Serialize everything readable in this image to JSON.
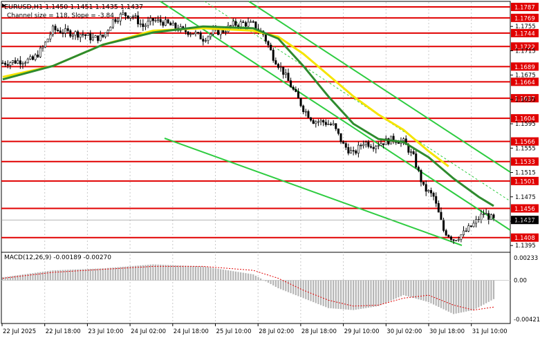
{
  "header": {
    "symbol_line": "EURUSD,H1  1.1450 1.1451 1.1435 1.1437",
    "channel_line": "Channel size = 118, Slope = -3.84"
  },
  "macd": {
    "label": "MACD(12,26,9) -0.00189 -0.00270",
    "scale_ticks": [
      "0.00233",
      "0.00",
      "-0.00421"
    ]
  },
  "price_scale": {
    "ticks": [
      "1.1755",
      "1.1715",
      "1.1675",
      "1.1635",
      "1.1595",
      "1.1555",
      "1.1515",
      "1.1475",
      "1.1435",
      "1.1395"
    ]
  },
  "levels": [
    {
      "label": "1.1787",
      "value": 1.1787
    },
    {
      "label": "1.1769",
      "value": 1.1769
    },
    {
      "label": "1.1744",
      "value": 1.1744
    },
    {
      "label": "1.1722",
      "value": 1.1722
    },
    {
      "label": "1.1689",
      "value": 1.1689
    },
    {
      "label": "1.1664",
      "value": 1.1664
    },
    {
      "label": "1.1637",
      "value": 1.1637
    },
    {
      "label": "1.1604",
      "value": 1.1604
    },
    {
      "label": "1.1566",
      "value": 1.1566
    },
    {
      "label": "1.1533",
      "value": 1.1533
    },
    {
      "label": "1.1501",
      "value": 1.1501
    },
    {
      "label": "1.1456",
      "value": 1.1456
    },
    {
      "label": "1.1408",
      "value": 1.1408
    }
  ],
  "current_price": {
    "label": "1.1437",
    "value": 1.1437
  },
  "time_axis": {
    "labels": [
      "22 Jul 2025",
      "22 Jul 18:00",
      "23 Jul 10:00",
      "24 Jul 02:00",
      "24 Jul 18:00",
      "25 Jul 10:00",
      "28 Jul 02:00",
      "28 Jul 18:00",
      "29 Jul 10:00",
      "30 Jul 02:00",
      "30 Jul 18:00",
      "31 Jul 10:00"
    ]
  },
  "chart_data": {
    "type": "candlestick",
    "symbol": "EURUSD",
    "timeframe": "H1",
    "ylim": [
      1.1385,
      1.1795
    ],
    "close_path": [
      [
        0,
        1.1695
      ],
      [
        6,
        1.1698
      ],
      [
        12,
        1.17
      ],
      [
        16,
        1.172
      ],
      [
        20,
        1.175
      ],
      [
        26,
        1.1745
      ],
      [
        32,
        1.1742
      ],
      [
        36,
        1.1735
      ],
      [
        40,
        1.1738
      ],
      [
        44,
        1.1765
      ],
      [
        48,
        1.1775
      ],
      [
        52,
        1.1772
      ],
      [
        56,
        1.1755
      ],
      [
        60,
        1.1765
      ],
      [
        64,
        1.1762
      ],
      [
        68,
        1.1755
      ],
      [
        72,
        1.1748
      ],
      [
        76,
        1.1745
      ],
      [
        80,
        1.1735
      ],
      [
        84,
        1.1745
      ],
      [
        88,
        1.1748
      ],
      [
        92,
        1.1758
      ],
      [
        96,
        1.176
      ],
      [
        100,
        1.1758
      ],
      [
        104,
        1.1742
      ],
      [
        108,
        1.1705
      ],
      [
        112,
        1.168
      ],
      [
        116,
        1.165
      ],
      [
        120,
        1.162
      ],
      [
        124,
        1.16
      ],
      [
        128,
        1.1598
      ],
      [
        132,
        1.1592
      ],
      [
        136,
        1.156
      ],
      [
        140,
        1.1545
      ],
      [
        144,
        1.1565
      ],
      [
        148,
        1.156
      ],
      [
        152,
        1.1565
      ],
      [
        156,
        1.157
      ],
      [
        160,
        1.1565
      ],
      [
        164,
        1.154
      ],
      [
        168,
        1.149
      ],
      [
        172,
        1.1475
      ],
      [
        176,
        1.142
      ],
      [
        180,
        1.1405
      ],
      [
        184,
        1.1415
      ],
      [
        188,
        1.143
      ],
      [
        192,
        1.1448
      ],
      [
        196,
        1.1437
      ]
    ],
    "sma_green_label": "",
    "sma_yellow_label": "",
    "sma_green": [
      [
        0,
        1.1668
      ],
      [
        20,
        1.169
      ],
      [
        40,
        1.1725
      ],
      [
        60,
        1.1745
      ],
      [
        80,
        1.1755
      ],
      [
        100,
        1.1752
      ],
      [
        110,
        1.1735
      ],
      [
        120,
        1.169
      ],
      [
        130,
        1.164
      ],
      [
        140,
        1.1595
      ],
      [
        150,
        1.157
      ],
      [
        160,
        1.1565
      ],
      [
        170,
        1.154
      ],
      [
        180,
        1.1505
      ],
      [
        190,
        1.1475
      ],
      [
        196,
        1.146
      ]
    ],
    "sma_yellow": [
      [
        0,
        1.1672
      ],
      [
        20,
        1.169
      ],
      [
        40,
        1.1725
      ],
      [
        60,
        1.1748
      ],
      [
        80,
        1.1752
      ],
      [
        100,
        1.1748
      ],
      [
        110,
        1.1738
      ],
      [
        120,
        1.171
      ],
      [
        130,
        1.1675
      ],
      [
        140,
        1.164
      ],
      [
        150,
        1.161
      ],
      [
        160,
        1.1585
      ],
      [
        170,
        1.155
      ],
      [
        178,
        1.1525
      ]
    ],
    "macd_hist": [
      [
        0,
        0.0003
      ],
      [
        20,
        0.001
      ],
      [
        40,
        0.0012
      ],
      [
        60,
        0.0016
      ],
      [
        80,
        0.0014
      ],
      [
        100,
        0.0006
      ],
      [
        110,
        -0.0008
      ],
      [
        120,
        -0.0018
      ],
      [
        130,
        -0.0028
      ],
      [
        140,
        -0.003
      ],
      [
        150,
        -0.0026
      ],
      [
        160,
        -0.0015
      ],
      [
        170,
        -0.0022
      ],
      [
        180,
        -0.0034
      ],
      [
        188,
        -0.003
      ],
      [
        196,
        -0.0019
      ]
    ],
    "macd_signal": [
      [
        0,
        0.0002
      ],
      [
        20,
        0.0008
      ],
      [
        40,
        0.0011
      ],
      [
        60,
        0.0014
      ],
      [
        80,
        0.0014
      ],
      [
        100,
        0.001
      ],
      [
        110,
        0.0002
      ],
      [
        120,
        -0.001
      ],
      [
        130,
        -0.002
      ],
      [
        140,
        -0.0026
      ],
      [
        150,
        -0.0025
      ],
      [
        160,
        -0.0018
      ],
      [
        170,
        -0.0015
      ],
      [
        180,
        -0.0025
      ],
      [
        188,
        -0.003
      ],
      [
        196,
        -0.0027
      ]
    ]
  }
}
